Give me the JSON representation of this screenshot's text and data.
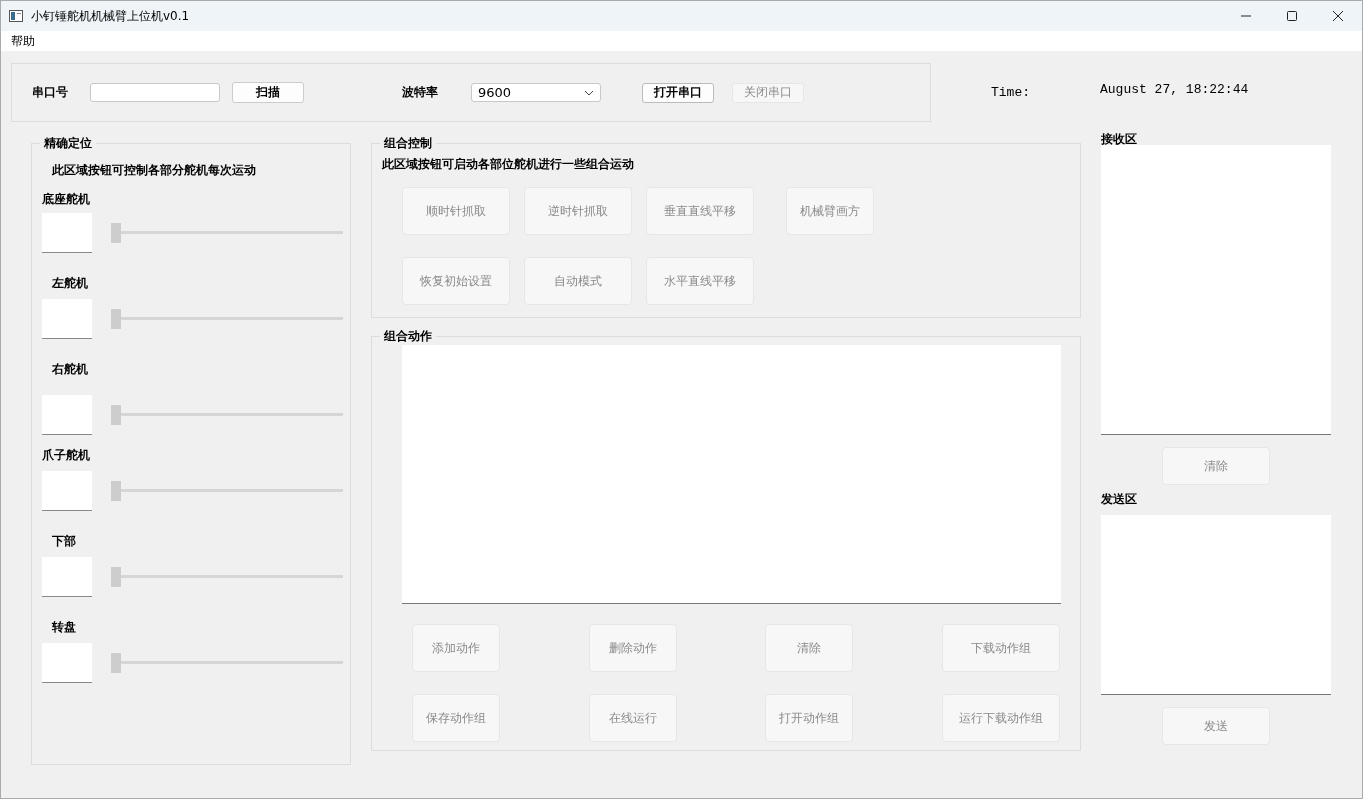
{
  "window": {
    "title": "小钉锤舵机机械臂上位机v0.1"
  },
  "menu": [
    {
      "label": "帮助"
    }
  ],
  "serial": {
    "port_label": "串口号",
    "scan_button": {
      "label": "扫描",
      "disabled": false
    },
    "baud_label": "波特率",
    "baud_value": "9600",
    "buttons": [
      {
        "label": "打开串口",
        "disabled": false
      },
      {
        "label": "关闭串口",
        "disabled": true
      }
    ]
  },
  "time": {
    "label": "Time:",
    "value": "August 27, 18:22:44"
  },
  "precise": {
    "title": "精确定位",
    "description": "此区域按钮可控制各部分舵机每次运动",
    "servos": [
      {
        "name": "底座舵机",
        "level": 0
      },
      {
        "name": "左舵机",
        "level": 0
      },
      {
        "name": "右舵机",
        "level": 0
      },
      {
        "name": "爪子舵机",
        "level": 0
      },
      {
        "name": "下部",
        "level": 0
      },
      {
        "name": "转盘",
        "level": 0
      }
    ]
  },
  "combo_control": {
    "title": "组合控制",
    "description": "此区域按钮可启动各部位舵机进行一些组合运动",
    "buttons": [
      {
        "label": "顺时针抓取",
        "disabled": true
      },
      {
        "label": "逆时针抓取",
        "disabled": true
      },
      {
        "label": "垂直直线平移",
        "disabled": true
      },
      {
        "label": "机械臂画方",
        "disabled": true
      },
      {
        "label": "恢复初始设置",
        "disabled": true
      },
      {
        "label": "自动模式",
        "disabled": true
      },
      {
        "label": "水平直线平移",
        "disabled": true
      }
    ]
  },
  "combo_actions": {
    "title": "组合动作",
    "buttons": [
      {
        "label": "添加动作",
        "disabled": true
      },
      {
        "label": "删除动作",
        "disabled": true
      },
      {
        "label": "清除",
        "disabled": true
      },
      {
        "label": "下载动作组",
        "disabled": true
      },
      {
        "label": "保存动作组",
        "disabled": true
      },
      {
        "label": "在线运行",
        "disabled": true
      },
      {
        "label": "打开动作组",
        "disabled": true
      },
      {
        "label": "运行下载动作组",
        "disabled": true
      }
    ]
  },
  "receive": {
    "title": "接收区",
    "button": {
      "label": "清除",
      "disabled": true
    }
  },
  "send": {
    "title": "发送区",
    "button": {
      "label": "发送",
      "disabled": true
    }
  }
}
